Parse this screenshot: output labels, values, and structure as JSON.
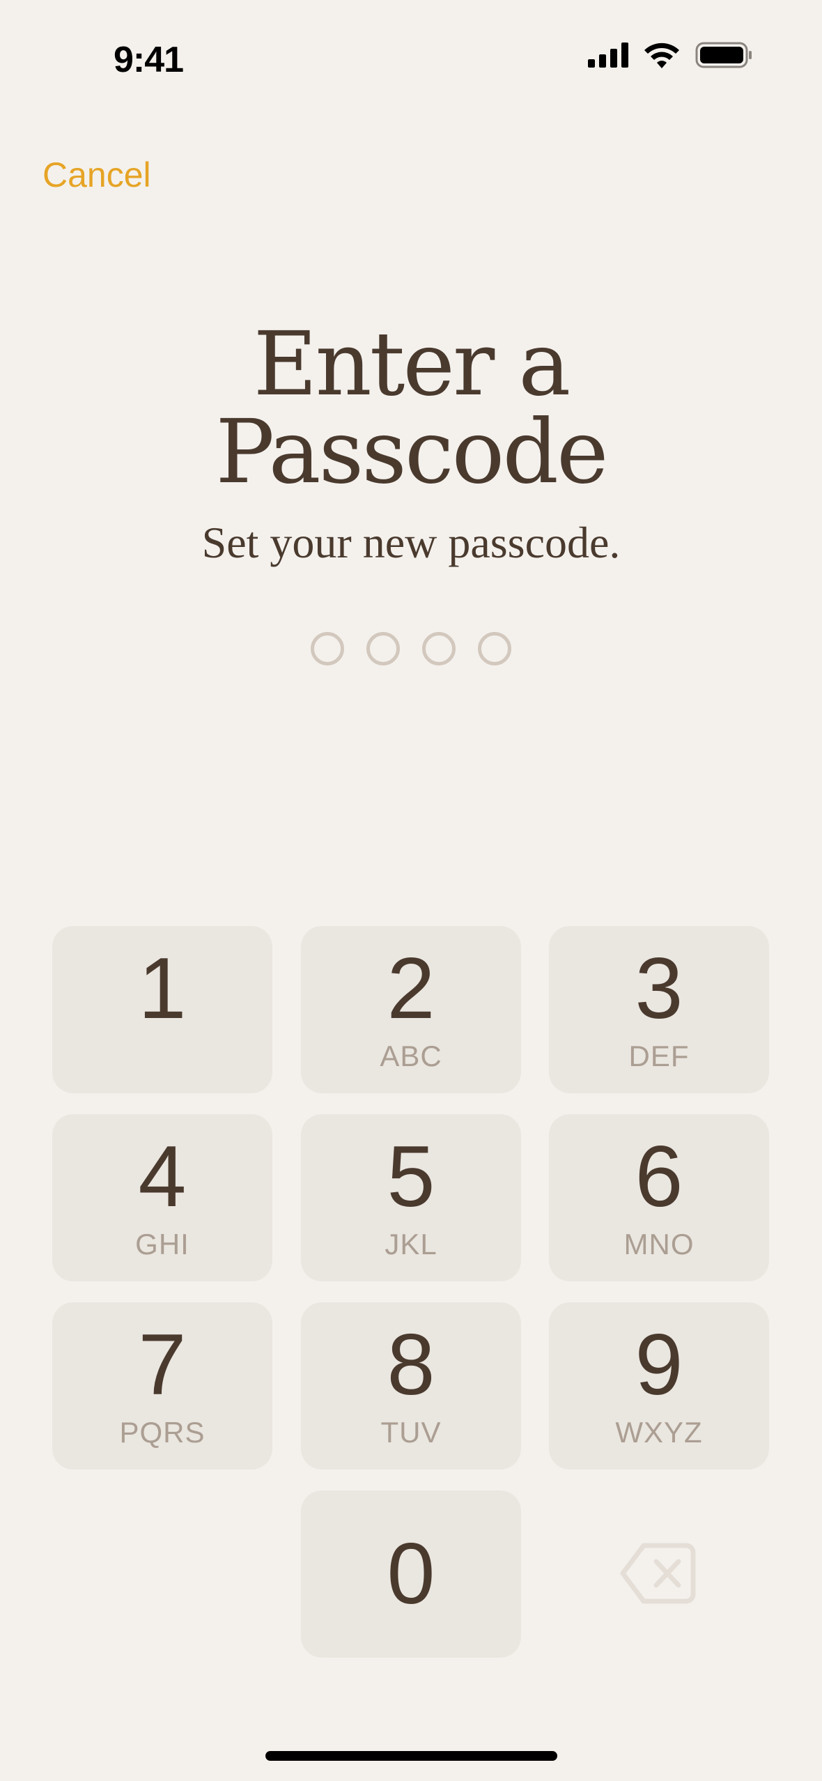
{
  "status": {
    "time": "9:41",
    "icons": [
      "cellular-signal-icon",
      "wifi-icon",
      "battery-icon"
    ]
  },
  "nav": {
    "cancel_label": "Cancel"
  },
  "header": {
    "title_line1": "Enter a",
    "title_line2": "Passcode",
    "subtitle": "Set your new passcode."
  },
  "passcode": {
    "length": 4,
    "filled": 0
  },
  "keypad": {
    "keys": [
      {
        "digit": "1",
        "letters": ""
      },
      {
        "digit": "2",
        "letters": "ABC"
      },
      {
        "digit": "3",
        "letters": "DEF"
      },
      {
        "digit": "4",
        "letters": "GHI"
      },
      {
        "digit": "5",
        "letters": "JKL"
      },
      {
        "digit": "6",
        "letters": "MNO"
      },
      {
        "digit": "7",
        "letters": "PQRS"
      },
      {
        "digit": "8",
        "letters": "TUV"
      },
      {
        "digit": "9",
        "letters": "WXYZ"
      },
      {
        "digit": "0",
        "letters": ""
      }
    ],
    "delete_icon": "delete-backspace-icon"
  },
  "colors": {
    "background": "#f4f1ed",
    "accent": "#e6a426",
    "text": "#4a3a2e",
    "key_bg": "#eae6e0",
    "key_letters": "#ab9e92",
    "dot_stroke": "#d3c8bd"
  }
}
